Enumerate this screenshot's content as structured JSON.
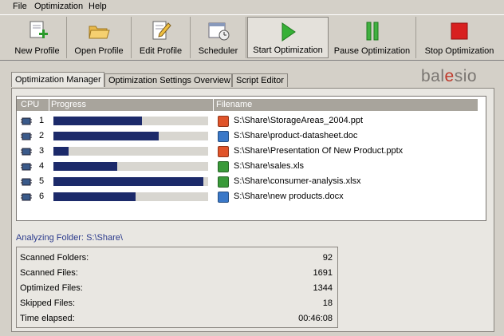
{
  "menu": [
    "File",
    "Optimization",
    "Help"
  ],
  "toolbar": [
    {
      "label": "New Profile",
      "icon": "new-profile-icon"
    },
    {
      "label": "Open Profile",
      "icon": "folder-open-icon"
    },
    {
      "label": "Edit Profile",
      "icon": "edit-document-icon"
    },
    {
      "label": "Scheduler",
      "icon": "calendar-clock-icon"
    },
    {
      "label": "Start Optimization",
      "icon": "play-icon"
    },
    {
      "label": "Pause Optimization",
      "icon": "pause-icon"
    },
    {
      "label": "Stop Optimization",
      "icon": "stop-icon"
    }
  ],
  "tabs": [
    "Optimization Manager",
    "Optimization Settings Overview",
    "Script Editor"
  ],
  "brand": {
    "pre": "bal",
    "hl": "e",
    "post": "sio"
  },
  "list": {
    "headers": {
      "cpu": "CPU",
      "progress": "Progress",
      "filename": "Filename"
    },
    "rows": [
      {
        "cpu": "1",
        "progress": 0.57,
        "file": "S:\\Share\\StorageAreas_2004.ppt",
        "type": "ppt"
      },
      {
        "cpu": "2",
        "progress": 0.68,
        "file": "S:\\Share\\product-datasheet.doc",
        "type": "doc"
      },
      {
        "cpu": "3",
        "progress": 0.1,
        "file": "S:\\Share\\Presentation Of New Product.pptx",
        "type": "ppt"
      },
      {
        "cpu": "4",
        "progress": 0.41,
        "file": "S:\\Share\\sales.xls",
        "type": "xls"
      },
      {
        "cpu": "5",
        "progress": 0.97,
        "file": "S:\\Share\\consumer-analysis.xlsx",
        "type": "xls"
      },
      {
        "cpu": "6",
        "progress": 0.53,
        "file": "S:\\Share\\new products.docx",
        "type": "doc"
      }
    ]
  },
  "analyzing": {
    "label": "Analyzing Folder:",
    "path": "S:\\Share\\"
  },
  "stats": [
    {
      "key": "Scanned Folders:",
      "value": "92"
    },
    {
      "key": "Scanned Files:",
      "value": "1691"
    },
    {
      "key": "Optimized Files:",
      "value": "1344"
    },
    {
      "key": "Skipped Files:",
      "value": "18"
    },
    {
      "key": "Time elapsed:",
      "value": "00:46:08"
    }
  ],
  "colors": {
    "ppt": "#e0542a",
    "doc": "#3a78c8",
    "xls": "#3a9a3a",
    "progress": "#1c2a6a"
  }
}
